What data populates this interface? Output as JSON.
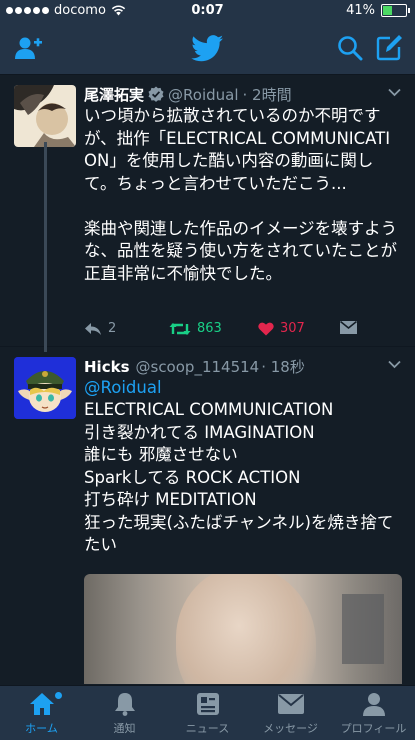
{
  "status_bar": {
    "carrier": "docomo",
    "time": "0:07",
    "battery": "41%",
    "battery_level": 0.41
  },
  "nav": {
    "icons": [
      "add-user-icon",
      "twitter-bird-icon",
      "search-icon",
      "compose-icon"
    ]
  },
  "tweets": [
    {
      "name": "尾澤拓実",
      "handle": "@Roidual",
      "time": "· 2時間",
      "verified": true,
      "text": "いつ頃から拡散されているのか不明ですが、拙作「ELECTRICAL COMMUNICATION」を使用した酷い内容の動画に関して。ちょっと言わせていただこう...\n\n楽曲や関連した作品のイメージを壊すような、品性を疑う使い方をされていたことが正直非常に不愉快でした。",
      "replies": "2",
      "retweets": "863",
      "likes": "307"
    },
    {
      "name": "Hicks",
      "handle": "@scoop_114514",
      "time": "· 18秒",
      "mention": "@Roidual",
      "text": "ELECTRICAL COMMUNICATION\n引き裂かれてる IMAGINATION\n誰にも 邪魔させない\nSparkしてる ROCK ACTION\n打ち砕け MEDITATION\n狂った現実(ふたばチャンネル)を焼き捨てたい"
    }
  ],
  "tabs": [
    {
      "label": "ホーム",
      "icon": "home-icon",
      "active": true
    },
    {
      "label": "通知",
      "icon": "bell-icon",
      "active": false
    },
    {
      "label": "ニュース",
      "icon": "news-icon",
      "active": false
    },
    {
      "label": "メッセージ",
      "icon": "envelope-icon",
      "active": false
    },
    {
      "label": "プロフィール",
      "icon": "person-icon",
      "active": false
    }
  ],
  "colors": {
    "background": "#141d26",
    "bar": "#243447",
    "accent": "#1da1f2",
    "retweet": "#19cf86",
    "like": "#e2264d",
    "muted": "#8899a6"
  }
}
